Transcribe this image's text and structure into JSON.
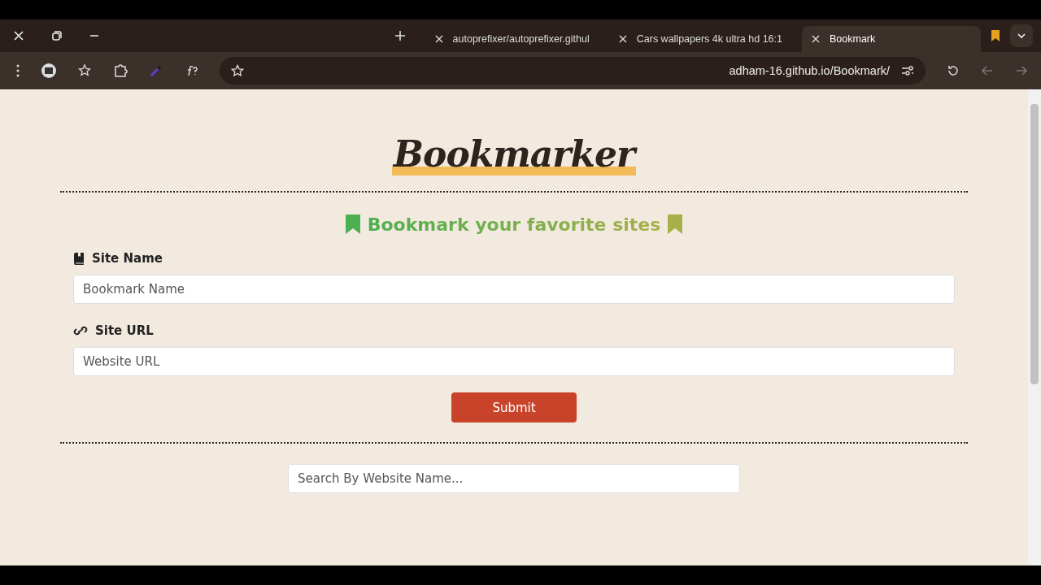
{
  "browser": {
    "tabs": [
      {
        "title": "autoprefixer/autoprefixer.githul",
        "selected": false
      },
      {
        "title": "Cars wallpapers 4k ultra hd 16:1",
        "selected": false
      },
      {
        "title": "Bookmark",
        "selected": true
      }
    ],
    "address": "adham-16.github.io/Bookmark/"
  },
  "page": {
    "logo": "Bookmarker",
    "subtitle": "Bookmark your favorite sites",
    "fields": [
      {
        "label": "Site Name",
        "placeholder": "Bookmark Name",
        "kind": "name"
      },
      {
        "label": "Site URL",
        "placeholder": "Website URL",
        "kind": "url"
      }
    ],
    "submit": "Submit",
    "search": {
      "placeholder": "Search By Website Name..."
    }
  }
}
